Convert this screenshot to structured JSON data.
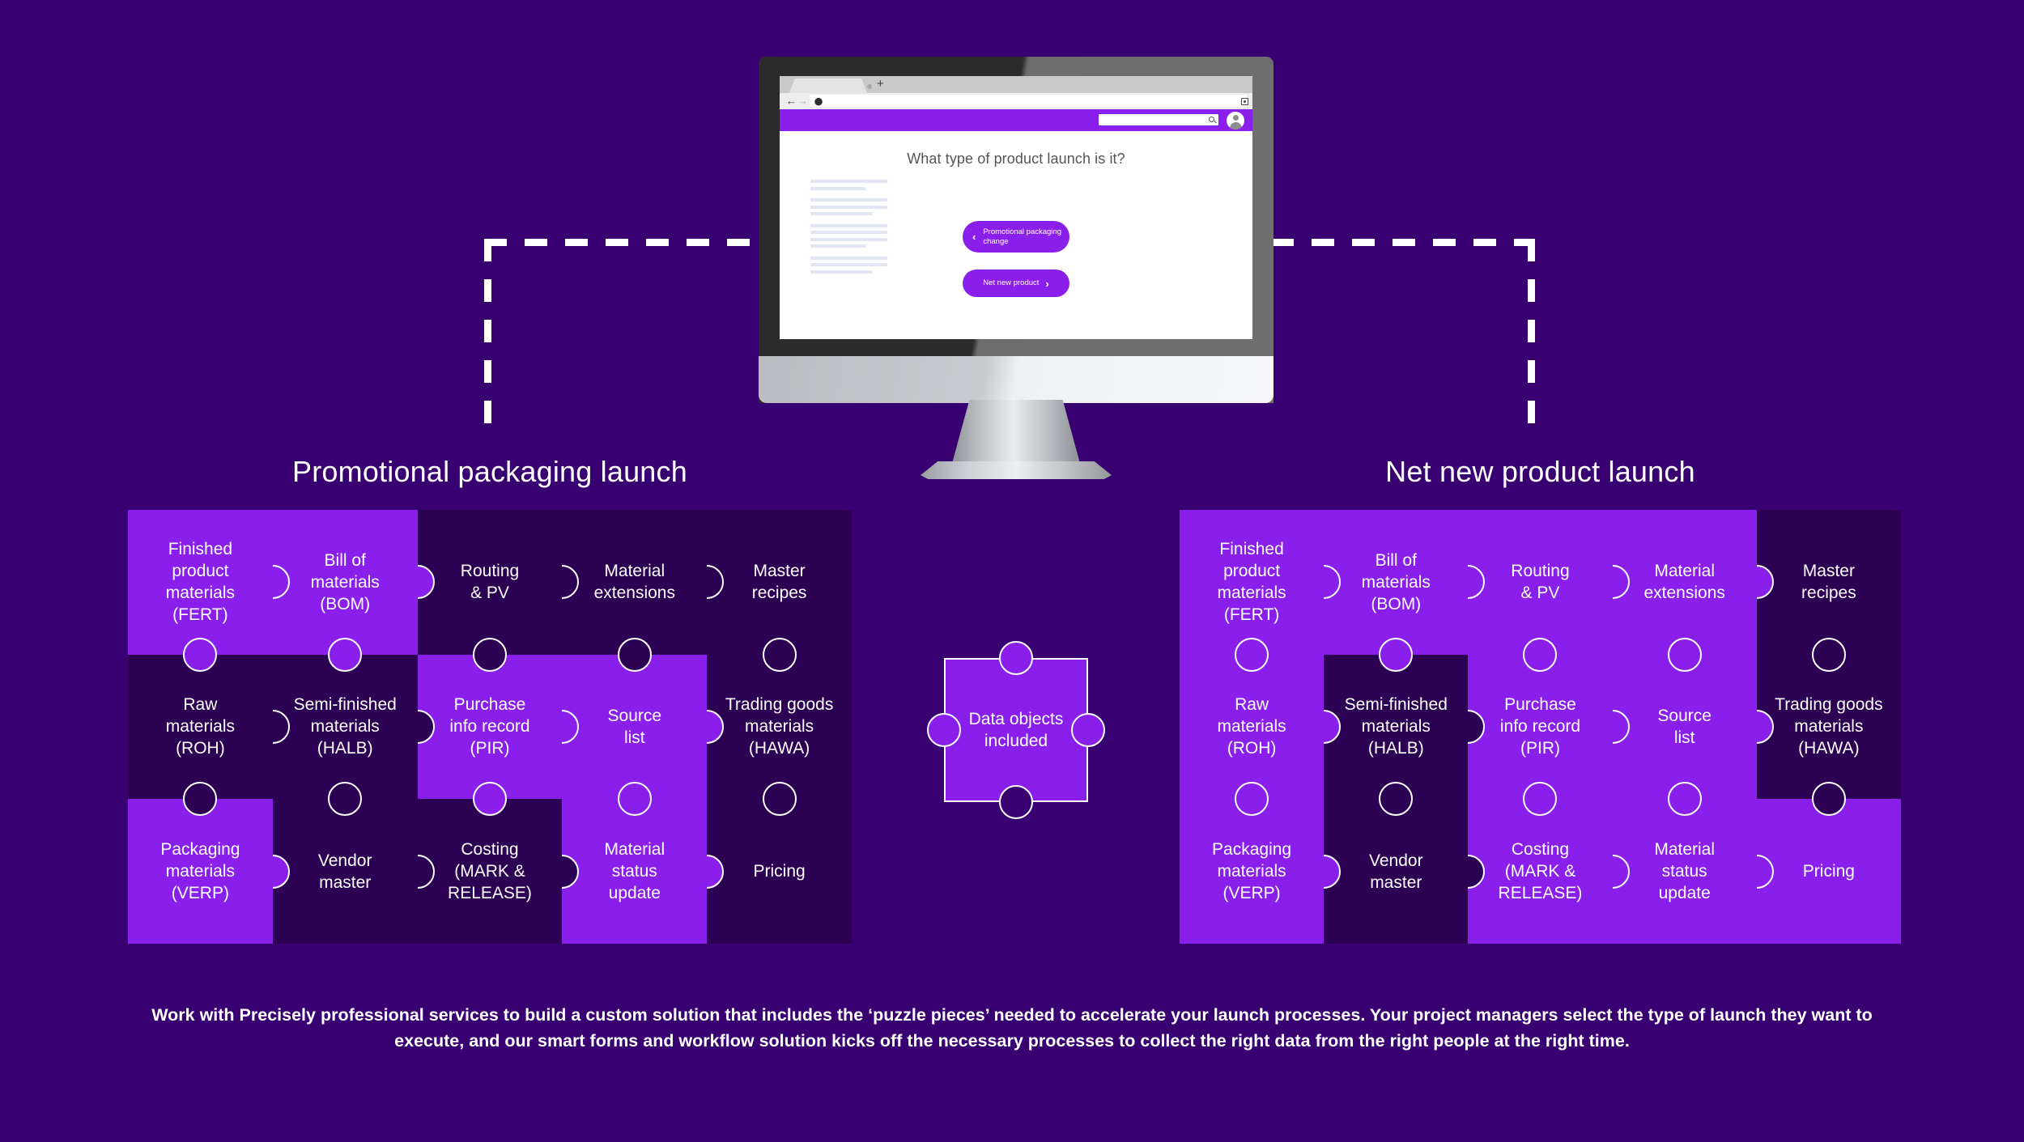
{
  "colors": {
    "background": "#380070",
    "highlight": "#8A1EEB",
    "inactive": "#2C0053",
    "outline": "#FFFFFF"
  },
  "monitor": {
    "browser": {
      "tab_label": "",
      "new_tab_label": "+",
      "back_icon": "back-arrow-icon",
      "forward_icon": "forward-arrow-icon",
      "url_value": "",
      "extension_icon": "extension-icon",
      "search_placeholder": "",
      "search_icon": "search-icon",
      "avatar_icon": "user-avatar-icon"
    },
    "page": {
      "question": "What type of product launch is it?",
      "buttons": [
        {
          "label": "Promotional\npackaging change",
          "chevron": "chevron-left-icon",
          "chevron_side": "left"
        },
        {
          "label": "Net new product",
          "chevron": "chevron-right-icon",
          "chevron_side": "right"
        }
      ]
    }
  },
  "legend": {
    "label": "Data objects\nincluded"
  },
  "grids": [
    {
      "id": "promotional",
      "title": "Promotional packaging launch",
      "cells": [
        {
          "label": "Finished\nproduct\nmaterials\n(FERT)",
          "active": true
        },
        {
          "label": "Bill of\nmaterials\n(BOM)",
          "active": true
        },
        {
          "label": "Routing\n& PV",
          "active": false
        },
        {
          "label": "Material\nextensions",
          "active": false
        },
        {
          "label": "Master\nrecipes",
          "active": false
        },
        {
          "label": "Raw\nmaterials\n(ROH)",
          "active": false
        },
        {
          "label": "Semi-finished\nmaterials\n(HALB)",
          "active": false
        },
        {
          "label": "Purchase\ninfo record\n(PIR)",
          "active": true
        },
        {
          "label": "Source\nlist",
          "active": true
        },
        {
          "label": "Trading goods\nmaterials\n(HAWA)",
          "active": false
        },
        {
          "label": "Packaging\nmaterials\n(VERP)",
          "active": true
        },
        {
          "label": "Vendor\nmaster",
          "active": false
        },
        {
          "label": "Costing\n(MARK &\nRELEASE)",
          "active": false
        },
        {
          "label": "Material\nstatus\nupdate",
          "active": true
        },
        {
          "label": "Pricing",
          "active": false
        }
      ]
    },
    {
      "id": "netnew",
      "title": "Net new product launch",
      "cells": [
        {
          "label": "Finished\nproduct\nmaterials\n(FERT)",
          "active": true
        },
        {
          "label": "Bill of\nmaterials\n(BOM)",
          "active": true
        },
        {
          "label": "Routing\n& PV",
          "active": true
        },
        {
          "label": "Material\nextensions",
          "active": true
        },
        {
          "label": "Master\nrecipes",
          "active": false
        },
        {
          "label": "Raw\nmaterials\n(ROH)",
          "active": true
        },
        {
          "label": "Semi-finished\nmaterials\n(HALB)",
          "active": false
        },
        {
          "label": "Purchase\ninfo record\n(PIR)",
          "active": true
        },
        {
          "label": "Source\nlist",
          "active": true
        },
        {
          "label": "Trading goods\nmaterials\n(HAWA)",
          "active": false
        },
        {
          "label": "Packaging\nmaterials\n(VERP)",
          "active": true
        },
        {
          "label": "Vendor\nmaster",
          "active": false
        },
        {
          "label": "Costing\n(MARK &\nRELEASE)",
          "active": true
        },
        {
          "label": "Material\nstatus\nupdate",
          "active": true
        },
        {
          "label": "Pricing",
          "active": true
        }
      ]
    }
  ],
  "caption": "Work with Precisely professional services to build a custom solution that includes the ‘puzzle pieces’ needed to accelerate your launch processes. Your project managers select the type of launch they want to execute, and our smart forms and workflow solution kicks off the necessary processes to collect the right data from the right people at the right time."
}
